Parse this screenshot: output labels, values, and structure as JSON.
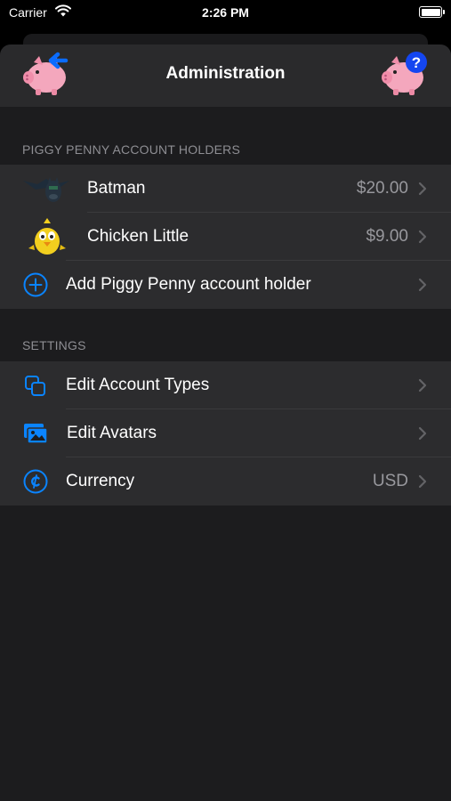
{
  "status_bar": {
    "carrier": "Carrier",
    "time": "2:26 PM"
  },
  "nav": {
    "title": "Administration",
    "left_icon": "piggy-bank-back-icon",
    "right_icon": "piggy-bank-help-icon"
  },
  "account_holders": {
    "header": "PIGGY PENNY ACCOUNT HOLDERS",
    "items": [
      {
        "name": "Batman",
        "balance": "$20.00",
        "avatar": "batman-avatar"
      },
      {
        "name": "Chicken Little",
        "balance": "$9.00",
        "avatar": "chicken-little-avatar"
      }
    ],
    "add_label": "Add Piggy Penny account holder"
  },
  "settings": {
    "header": "SETTINGS",
    "items": [
      {
        "label": "Edit Account Types",
        "value": "",
        "icon": "square-stack-icon"
      },
      {
        "label": "Edit Avatars",
        "value": "",
        "icon": "photo-stack-icon"
      },
      {
        "label": "Currency",
        "value": "USD",
        "icon": "cent-sign-icon"
      }
    ]
  },
  "colors": {
    "accent": "#0a84ff",
    "background": "#1c1c1e",
    "row_background": "#2c2c2e",
    "secondary_text": "#98989d"
  }
}
